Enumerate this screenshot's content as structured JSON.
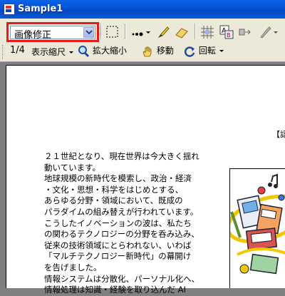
{
  "window": {
    "title": "Sample1"
  },
  "toolbar1": {
    "mode_select": {
      "value": "画像修正"
    }
  },
  "toolbar2": {
    "zoom_ratio": "1/4",
    "display_scale_label": "表示縮尺",
    "zoom_label": "拡大縮小",
    "move_label": "移動",
    "rotate_label": "回転"
  },
  "document": {
    "header_fragment": "【認",
    "body_lines": [
      "２１世紀となり、現在世界は今大きく揺れ",
      "動いています。",
      "地球規模の新時代を模索し、政治・経済",
      "・文化・思想・科学をはじめとする、",
      "あらゆる分野・領域において、既成の",
      "パラダイムの組み替えが行われています。",
      "こうしたイノベーションの波は、私たち",
      "の関わるテクノロジーの分野を呑み込み、",
      "従来の技術領域にとらわれない、いわば",
      "「マルチテクノロジー新時代」の幕開け",
      "を告げました。",
      "情報システムは分散化、パーソナル化へ、",
      "情報処理は知識・経験を取り込んだ AI"
    ]
  }
}
